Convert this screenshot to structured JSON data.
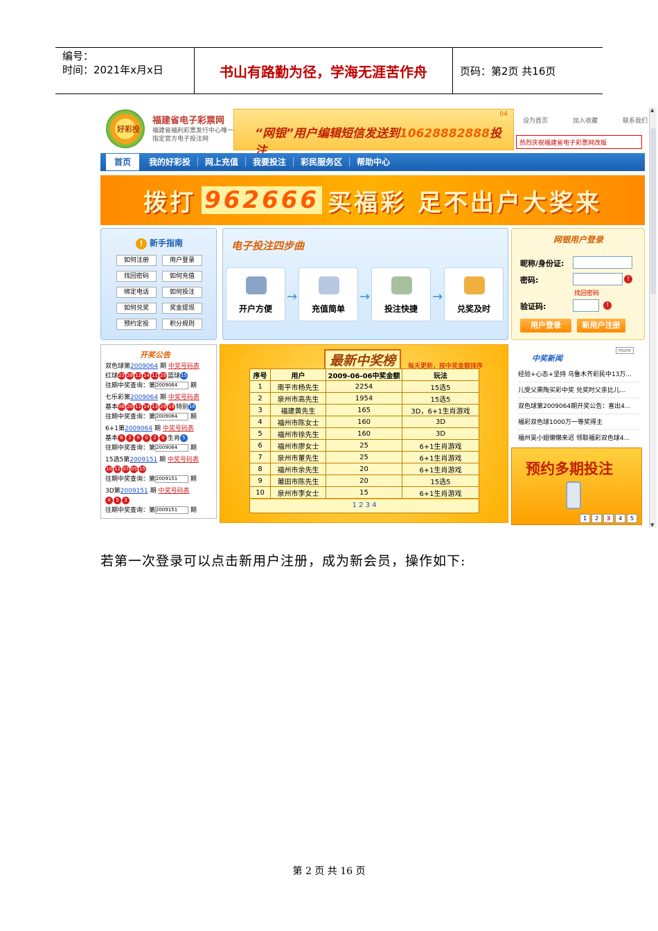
{
  "header": {
    "number_label": "编号：",
    "date": "时间：2021年x月x日",
    "motto": "书山有路勤为径，学海无涯苦作舟",
    "page": "页码：第2页  共16页"
  },
  "site": {
    "logo_text": "好彩投",
    "name": "福建省电子彩票网",
    "subtitle": "福建省福利彩票发行中心唯一指定官方电子投注网",
    "banner_prefix": "“网银”用户编辑短信发送到",
    "banner_number": "10628882888",
    "banner_suffix": "投注",
    "banner_tag": "04",
    "links": [
      "设为首页",
      "加入收藏",
      "联系我们"
    ],
    "notice": "热烈庆祝福建省电子彩票网改版"
  },
  "nav": [
    "首页",
    "我的好彩投",
    "网上充值",
    "我要投注",
    "彩民服务区",
    "帮助中心"
  ],
  "banner2": {
    "pre": "拨打",
    "num": "962666",
    "post": "买福彩  足不出户大奖来"
  },
  "guide": {
    "title": "新手指南",
    "items": [
      "如何注册",
      "用户登录",
      "找回密码",
      "如何充值",
      "绑定电话",
      "如何投注",
      "如何兑奖",
      "奖金提现",
      "预约定投",
      "积分规则"
    ]
  },
  "steps": {
    "title": "电子投注四步曲",
    "items": [
      "开户方便",
      "充值简单",
      "投注快捷",
      "兑奖及时"
    ]
  },
  "login": {
    "title": "网银用户登录",
    "id_label": "昵称/身份证:",
    "pwd_label": "密码:",
    "forgot": "找回密码",
    "code_label": "验证码:",
    "login_btn": "用户登录",
    "register_btn": "新用户注册"
  },
  "lottery": {
    "title": "开奖公告",
    "ssq": "双色球第",
    "ssq_issue": "2009064",
    "qi": "期",
    "detail": "中奖号码表",
    "red_label": "红球",
    "red": [
      "23",
      "28",
      "12",
      "14",
      "11",
      "29"
    ],
    "blue_label": "蓝球",
    "blue": [
      "15"
    ],
    "query": "往期中奖查询：第",
    "sel": "2009064",
    "qlc": "七乐彩第",
    "qlc_issue": "2009064",
    "basic": "基本",
    "qlc_nums": [
      "08",
      "20",
      "11",
      "14",
      "13",
      "29",
      "19"
    ],
    "special": "特别",
    "qlc_sp": "16",
    "sjy": "6+1第",
    "sjy_issue": "2009064",
    "sjy_nums": [
      "6",
      "2",
      "9",
      "0",
      "2",
      "0"
    ],
    "zodiac": "生肖",
    "zodiac_val": "5",
    "x155": "15选5第",
    "x155_issue": "2009151",
    "x155_nums": [
      "10",
      "12",
      "07",
      "05",
      "15"
    ],
    "sel2": "2009151",
    "d3": "3D第",
    "d3_issue": "2009151",
    "d3_nums": [
      "4",
      "5",
      "3"
    ]
  },
  "winners": {
    "title": "最新中奖榜",
    "sub": "每天更新，按中奖金额排序",
    "headers": [
      "序号",
      "用户",
      "2009-06-06中奖金额",
      "玩法"
    ],
    "rows": [
      [
        "1",
        "南平市杨先生",
        "2254",
        "15选5"
      ],
      [
        "2",
        "泉州市高先生",
        "1954",
        "15选5"
      ],
      [
        "3",
        "福建黄先生",
        "165",
        "3D，6+1生肖游戏"
      ],
      [
        "4",
        "福州市陈女士",
        "160",
        "3D"
      ],
      [
        "5",
        "福州市徐先生",
        "160",
        "3D"
      ],
      [
        "6",
        "福州市廖女士",
        "25",
        "6+1生肖游戏"
      ],
      [
        "7",
        "泉州市董先生",
        "25",
        "6+1生肖游戏"
      ],
      [
        "8",
        "福州市余先生",
        "20",
        "6+1生肖游戏"
      ],
      [
        "9",
        "莆田市陈先生",
        "20",
        "15选5"
      ],
      [
        "10",
        "泉州市李女士",
        "15",
        "6+1生肖游戏"
      ]
    ],
    "pager": "1 2 3 4"
  },
  "news": {
    "title": "中奖新闻",
    "more": "more",
    "items": [
      "经验+心态+坚持 乌鲁木齐彩民中13万...",
      "儿受父熏陶买彩中奖 兑奖时父亲比儿...",
      "双色球第2009064期开奖公告：喜出4...",
      "福彩双色球1000万一等奖得主",
      "福州吴小姐懒懒来迟 领取福彩双色球4..."
    ]
  },
  "promo": {
    "text": "预约多期投注",
    "pages": [
      "1",
      "2",
      "3",
      "4",
      "5"
    ]
  },
  "paragraph": "若第一次登录可以点击新用户注册，成为新会员，操作如下:",
  "footer": "第 2 页 共 16 页"
}
